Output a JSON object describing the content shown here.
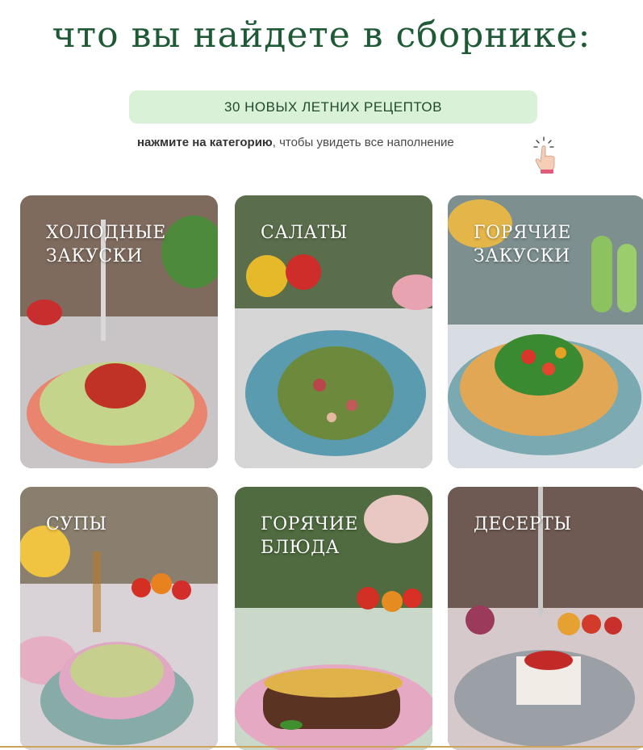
{
  "header": {
    "title": "что вы найдете в сборнике:",
    "pill_text": "30 НОВЫХ ЛЕТНИХ РЕЦЕПТОВ",
    "hint_bold": "нажмите на категорию",
    "hint_rest": ", чтобы увидеть все наполнение"
  },
  "categories": [
    {
      "label": "холодные закуски",
      "icon": "hummus-photo"
    },
    {
      "label": "салаты",
      "icon": "salad-photo"
    },
    {
      "label": "горячие закуски",
      "icon": "flatbread-photo"
    },
    {
      "label": "супы",
      "icon": "soup-photo"
    },
    {
      "label": "горячие блюда",
      "icon": "lasagna-photo"
    },
    {
      "label": "десерты",
      "icon": "dessert-photo"
    }
  ],
  "colors": {
    "title": "#1e5a36",
    "pill_bg": "#d9f1d6",
    "accent_line": "#c9a45a"
  }
}
